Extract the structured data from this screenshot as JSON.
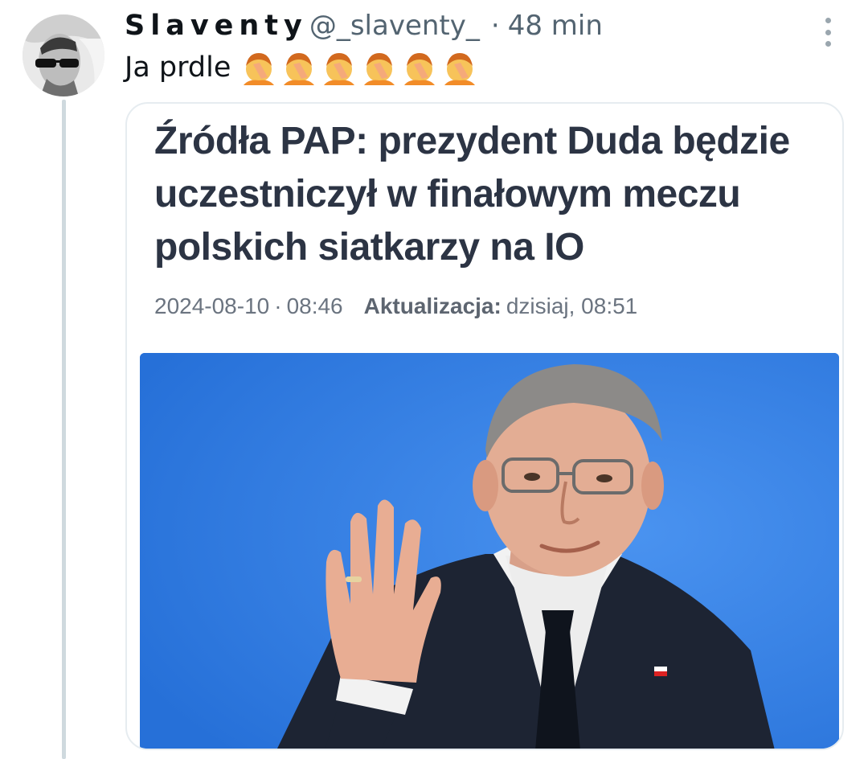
{
  "author": {
    "display_name": "Slaventy",
    "handle": "@_slaventy_",
    "time_ago": "48 min"
  },
  "tweet": {
    "text": "Ja prdle",
    "emoji": [
      "🤦",
      "🤦",
      "🤦",
      "🤦",
      "🤦",
      "🤦"
    ]
  },
  "card": {
    "headline": "Źródła PAP: prezydent Duda będzie uczestniczył w finałowym meczu polskich siatkarzy na IO",
    "date": "2024-08-10",
    "time": "08:46",
    "update_label": "Aktualizacja:",
    "update_value": "dzisiaj, 08:51"
  },
  "colors": {
    "photo_background": "#2f7be0",
    "headline": "#2c3444",
    "thread_line": "#cfd9de"
  },
  "icons": {
    "more": "more-vertical-icon"
  }
}
